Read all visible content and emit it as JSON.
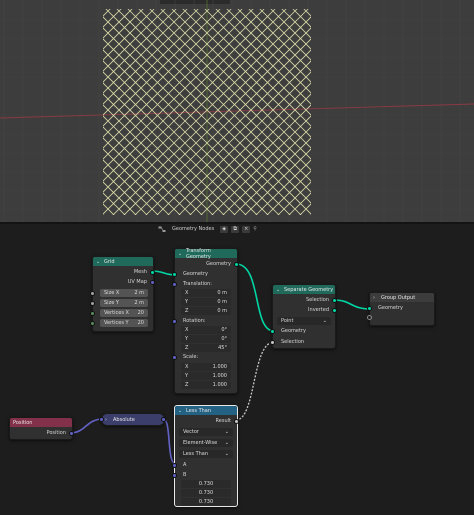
{
  "node_editor": {
    "header": {
      "tree_name": "Geometry Nodes"
    },
    "nodes": {
      "grid": {
        "title": "Grid",
        "outputs": [
          "Mesh",
          "UV Map"
        ],
        "fields": [
          {
            "label": "Size X",
            "value": "2 m"
          },
          {
            "label": "Size Y",
            "value": "2 m"
          },
          {
            "label": "Vertices X",
            "value": "20"
          },
          {
            "label": "Vertices Y",
            "value": "20"
          }
        ]
      },
      "transform": {
        "title": "Transform Geometry",
        "output": "Geometry",
        "input_geometry": "Geometry",
        "translation_label": "Translation:",
        "translation": [
          {
            "label": "X",
            "value": "0 m"
          },
          {
            "label": "Y",
            "value": "0 m"
          },
          {
            "label": "Z",
            "value": "0 m"
          }
        ],
        "rotation_label": "Rotation:",
        "rotation": [
          {
            "label": "X",
            "value": "0°"
          },
          {
            "label": "Y",
            "value": "0°"
          },
          {
            "label": "Z",
            "value": "45°"
          }
        ],
        "scale_label": "Scale:",
        "scale": [
          {
            "label": "X",
            "value": "1.000"
          },
          {
            "label": "Y",
            "value": "1.000"
          },
          {
            "label": "Z",
            "value": "1.000"
          }
        ]
      },
      "separate": {
        "title": "Separate Geometry",
        "outputs": [
          "Selection",
          "Inverted"
        ],
        "domain": "Point",
        "inputs": [
          "Geometry",
          "Selection"
        ]
      },
      "output": {
        "title": "Group Output",
        "input": "Geometry"
      },
      "position": {
        "title": "Position",
        "output": "Position"
      },
      "absolute": {
        "title": "Absolute"
      },
      "less_than": {
        "title": "Less Than",
        "output": "Result",
        "data_type": "Vector",
        "mode": "Element-Wise",
        "operation": "Less Than",
        "input_a": "A",
        "input_b": "B",
        "b_values": [
          "0.730",
          "0.730",
          "0.730"
        ]
      }
    }
  },
  "colors": {
    "geometry_socket": "#00d6a3",
    "vector_socket": "#6363c7",
    "wire_mesh": "#d8d8a8",
    "viewport_bg": "#3d3d3d"
  }
}
